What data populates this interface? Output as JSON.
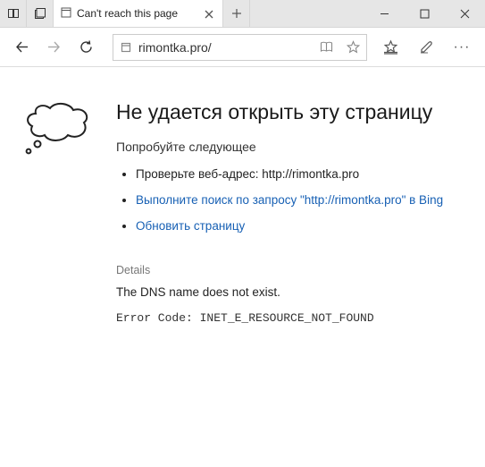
{
  "window": {
    "tab_title": "Can't reach this page"
  },
  "address": {
    "url": "rimontka.pro/"
  },
  "error": {
    "heading": "Не удается открыть эту страницу",
    "try_label": "Попробуйте следующее",
    "items": {
      "check": "Проверьте веб-адрес: http://rimontka.pro",
      "search": "Выполните поиск по запросу \"http://rimontka.pro\" в Bing",
      "refresh": "Обновить страницу"
    },
    "details_label": "Details",
    "dns_message": "The DNS name does not exist.",
    "code_label": "Error Code: ",
    "code_value": "INET_E_RESOURCE_NOT_FOUND"
  }
}
